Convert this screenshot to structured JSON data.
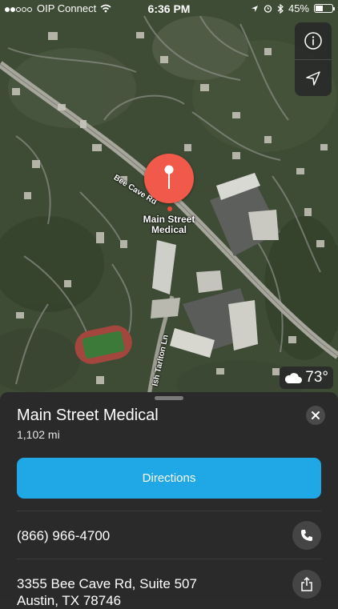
{
  "status_bar": {
    "carrier": "OIP Connect",
    "time": "6:36 PM",
    "battery_percent": "45%",
    "battery_level": 0.45
  },
  "map": {
    "road_labels": [
      "Bee Cave Rd",
      "Ish Tarlton Ln"
    ],
    "pin_label_line1": "Main Street",
    "pin_label_line2": "Medical",
    "pin_color": "#f15a4a",
    "weather": {
      "icon": "cloud-icon",
      "temperature": "73°"
    }
  },
  "place_card": {
    "title": "Main Street Medical",
    "distance": "1,102 mi",
    "directions_label": "Directions",
    "directions_color": "#1fa7e6",
    "phone": "(866) 966-4700",
    "address_line1": "3355 Bee Cave Rd, Suite 507",
    "address_line2": "Austin, TX 78746"
  }
}
